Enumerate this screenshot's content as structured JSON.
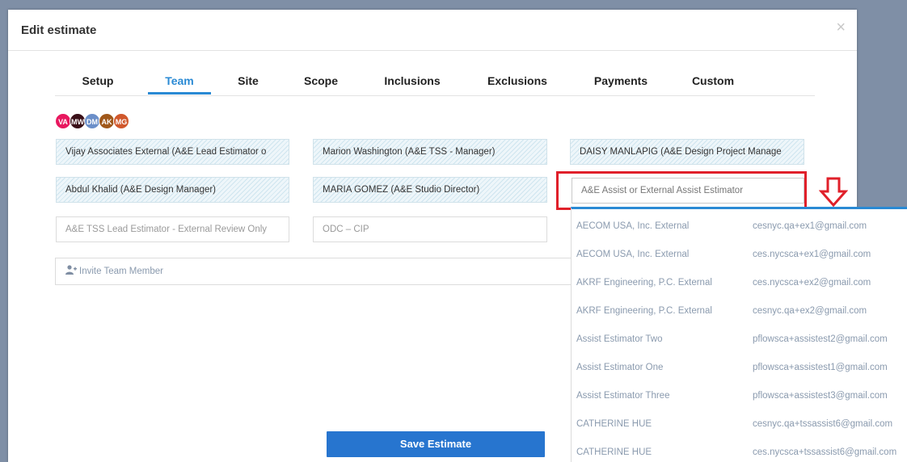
{
  "modal": {
    "title": "Edit estimate",
    "close_label": "×"
  },
  "tabs": [
    "Setup",
    "Team",
    "Site",
    "Scope",
    "Inclusions",
    "Exclusions",
    "Payments",
    "Custom"
  ],
  "active_tab": "Team",
  "avatars": [
    {
      "initials": "VA",
      "color": "#e8185f"
    },
    {
      "initials": "MW",
      "color": "#3a1018"
    },
    {
      "initials": "DM",
      "color": "#6b8fc9"
    },
    {
      "initials": "AK",
      "color": "#a0581a"
    },
    {
      "initials": "MG",
      "color": "#d0582c"
    }
  ],
  "team_fields": {
    "f1": "Vijay Associates External (A&E Lead Estimator o",
    "f2": "Marion Washington (A&E TSS - Manager)",
    "f3": "DAISY MANLAPIG (A&E Design Project Manage",
    "f4": "Abdul Khalid (A&E Design Manager)",
    "f5": "MARIA GOMEZ (A&E Studio Director)",
    "f6_placeholder": "A&E Assist or External Assist Estimator",
    "f7": "A&E  TSS Lead Estimator - External Review Only",
    "f8": "ODC – CIP"
  },
  "invite": {
    "placeholder": "Invite Team Member"
  },
  "save_label": "Save Estimate",
  "dropdown": [
    {
      "name": "AECOM USA, Inc. External",
      "email": "cesnyc.qa+ex1@gmail.com"
    },
    {
      "name": "AECOM USA, Inc. External",
      "email": "ces.nycsca+ex1@gmail.com"
    },
    {
      "name": "AKRF Engineering, P.C. External",
      "email": "ces.nycsca+ex2@gmail.com"
    },
    {
      "name": "AKRF Engineering, P.C. External",
      "email": "cesnyc.qa+ex2@gmail.com"
    },
    {
      "name": "Assist Estimator Two",
      "email": "pflowsca+assistest2@gmail.com"
    },
    {
      "name": "Assist Estimator One",
      "email": "pflowsca+assistest1@gmail.com"
    },
    {
      "name": "Assist Estimator Three",
      "email": "pflowsca+assistest3@gmail.com"
    },
    {
      "name": "CATHERINE HUE",
      "email": "cesnyc.qa+tssassist6@gmail.com"
    },
    {
      "name": "CATHERINE HUE",
      "email": "ces.nycsca+tssassist6@gmail.com"
    }
  ],
  "colors": {
    "accent": "#2a8ad4",
    "highlight": "#e0202a",
    "save": "#2775cf"
  }
}
